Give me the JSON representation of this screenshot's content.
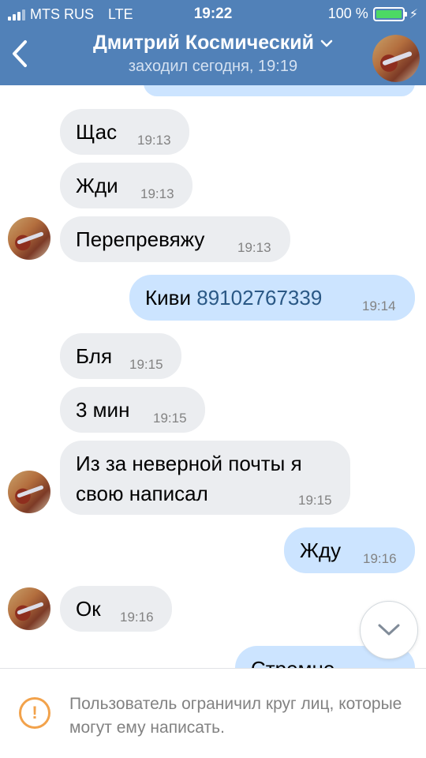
{
  "status_bar": {
    "carrier": "MTS RUS",
    "network": "LTE",
    "time": "19:22",
    "battery_text": "100 %",
    "battery_level": 1.0
  },
  "header": {
    "back_icon": "chevron-left-icon",
    "contact_name": "Дмитрий Космический",
    "dropdown_icon": "chevron-down-icon",
    "last_seen": "заходил сегодня, 19:19",
    "avatar": "contact-avatar"
  },
  "messages": [
    {
      "dir": "in",
      "text": "Щас",
      "time": "19:13"
    },
    {
      "dir": "in",
      "text": "Жди",
      "time": "19:13"
    },
    {
      "dir": "in",
      "text": "Перепревяжу",
      "time": "19:13"
    },
    {
      "dir": "out",
      "text": "Киви",
      "link": "89102767339",
      "time": "19:14"
    },
    {
      "dir": "in",
      "text": "Бля",
      "time": "19:15"
    },
    {
      "dir": "in",
      "text": "3 мин",
      "time": "19:15"
    },
    {
      "dir": "in",
      "line1": "Из за неверной почты я",
      "line2": "свою написал",
      "time": "19:15"
    },
    {
      "dir": "out",
      "text": "Жду",
      "time": "19:16"
    },
    {
      "dir": "in",
      "text": "Ок",
      "time": "19:16"
    },
    {
      "dir": "out",
      "text": "Стремно",
      "time": ""
    }
  ],
  "footer": {
    "icon": "warning-icon",
    "text": "Пользователь ограничил круг лиц, которые могут ему написать."
  },
  "colors": {
    "header_bg": "#5181b8",
    "incoming_bubble": "#ebedf0",
    "outgoing_bubble": "#cce4ff",
    "link": "#2a5885",
    "warning": "#f2a24b"
  }
}
